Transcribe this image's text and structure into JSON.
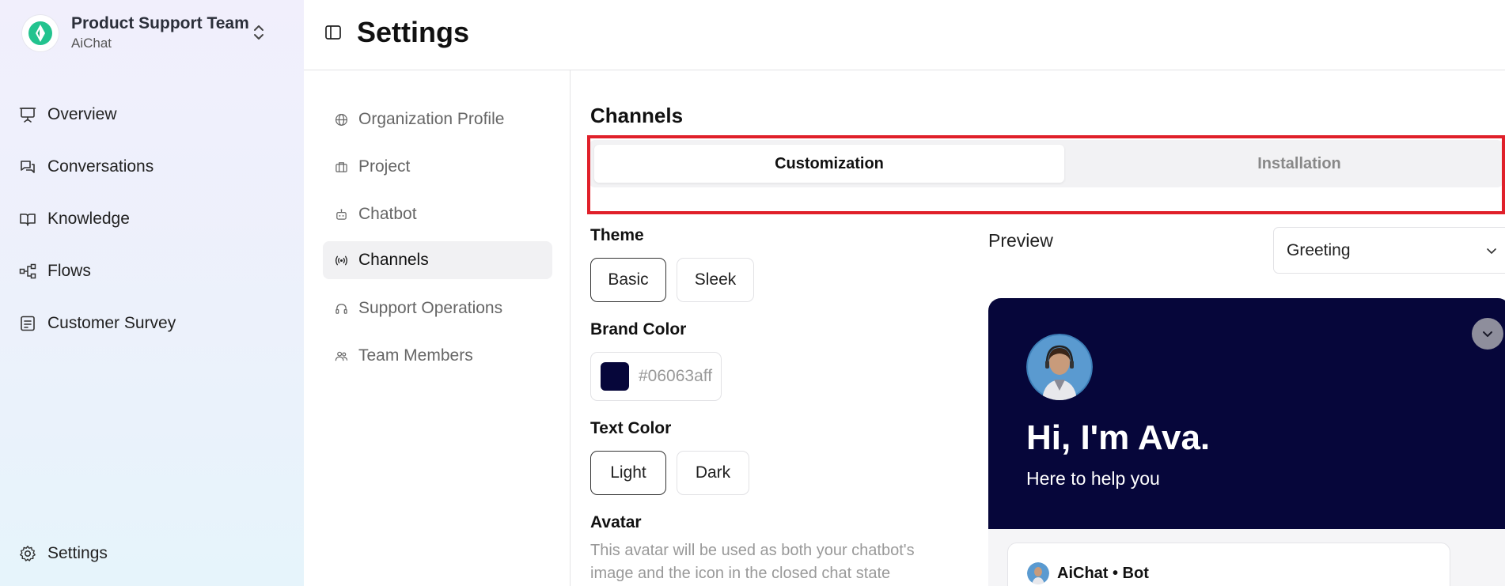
{
  "org": {
    "name": "Product Support Team",
    "subtitle": "AiChat",
    "brand_color": "#22c38e"
  },
  "sidebar": {
    "items": [
      {
        "label": "Overview",
        "icon": "presentation-icon"
      },
      {
        "label": "Conversations",
        "icon": "chat-bubbles-icon"
      },
      {
        "label": "Knowledge",
        "icon": "book-open-icon"
      },
      {
        "label": "Flows",
        "icon": "flow-nodes-icon"
      },
      {
        "label": "Customer Survey",
        "icon": "survey-form-icon"
      }
    ],
    "bottom": {
      "label": "Settings",
      "icon": "gear-icon"
    }
  },
  "header": {
    "title": "Settings"
  },
  "settings_nav": {
    "items": [
      {
        "label": "Organization Profile",
        "icon": "globe-icon"
      },
      {
        "label": "Project",
        "icon": "briefcase-icon"
      },
      {
        "label": "Chatbot",
        "icon": "bot-icon"
      },
      {
        "label": "Channels",
        "icon": "broadcast-icon",
        "active": true
      },
      {
        "label": "Support Operations",
        "icon": "headset-icon"
      },
      {
        "label": "Team Members",
        "icon": "users-icon"
      }
    ]
  },
  "channels": {
    "title": "Channels",
    "tabs": [
      {
        "label": "Customization",
        "active": true
      },
      {
        "label": "Installation",
        "active": false
      }
    ],
    "theme": {
      "label": "Theme",
      "options": [
        "Basic",
        "Sleek"
      ],
      "selected": "Basic"
    },
    "brand_color": {
      "label": "Brand Color",
      "value": "#06063aff",
      "swatch": "#06063a"
    },
    "text_color": {
      "label": "Text Color",
      "options": [
        "Light",
        "Dark"
      ],
      "selected": "Light"
    },
    "avatar": {
      "label": "Avatar",
      "description": "This avatar will be used as both your chatbot's image and the icon in the closed chat state"
    }
  },
  "preview": {
    "label": "Preview",
    "select_value": "Greeting",
    "greeting_title": "Hi, I'm Ava.",
    "greeting_subtitle": "Here to help you",
    "message_sender": "AiChat • Bot",
    "header_color": "#06063a"
  },
  "highlight_color": "#e0202a"
}
